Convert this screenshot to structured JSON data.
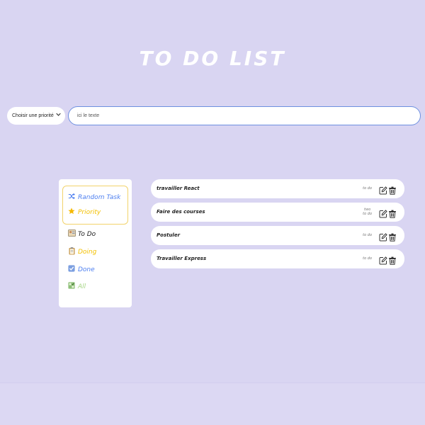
{
  "header": {
    "title": "TO DO LIST"
  },
  "priority_select": {
    "value": "Choisir une priorité",
    "icon": "chevron-down-icon"
  },
  "task_input": {
    "placeholder": "ici le texte"
  },
  "sidebar": {
    "random": {
      "label": "Random Task",
      "icon": "shuffle-icon",
      "color": "#4d7ff0"
    },
    "priority": {
      "label": "Priority",
      "icon": "star-icon",
      "color": "#f3c000"
    },
    "todo": {
      "label": "To Do",
      "icon": "todo-icon",
      "color": "#222222"
    },
    "doing": {
      "label": "Doing",
      "icon": "clipboard-icon",
      "color": "#f3c000"
    },
    "done": {
      "label": "Done",
      "icon": "checkbox-icon",
      "color": "#4d7ff0"
    },
    "all": {
      "label": "All",
      "icon": "all-icon",
      "color": "#a6d585"
    }
  },
  "tasks": [
    {
      "name": "travailler React",
      "status": "to do"
    },
    {
      "name": "Faire des courses",
      "status_line1": "two",
      "status_line2": "to do"
    },
    {
      "name": "Postuler",
      "status": "to do"
    },
    {
      "name": "Travailler Express",
      "status": "to do"
    }
  ]
}
